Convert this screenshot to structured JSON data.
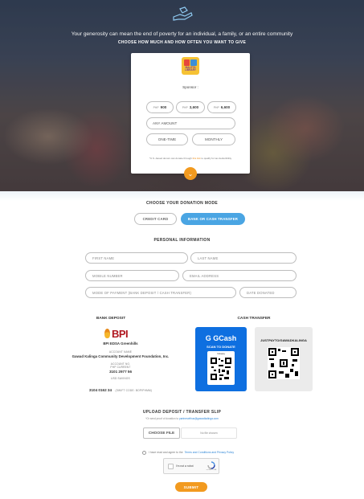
{
  "hero": {
    "tagline": "Your generosity can mean the end of poverty for an individual, a family, or an entire community",
    "subtitle": "CHOOSE HOW MUCH AND HOW OFTEN YOU WANT TO GIVE"
  },
  "card": {
    "logo_text": "MALETA LIBRARY",
    "sponsor_label": "Sponsor :",
    "amounts": [
      {
        "currency": "PHP",
        "value": "900"
      },
      {
        "currency": "PHP",
        "value": "3,600"
      },
      {
        "currency": "PHP",
        "value": "6,600"
      }
    ],
    "any_amount_placeholder": "ANY AMOUNT",
    "frequency": [
      "ONE-TIME",
      "MONTHLY"
    ],
    "tax_note_prefix": "*U.S.-based donors can donate through",
    "tax_note_link": "this link",
    "tax_note_suffix": "to qualify for tax deductibility"
  },
  "mode": {
    "title": "CHOOSE YOUR DONATION MODE",
    "credit_label": "CREDIT CARD",
    "bank_label": "BANK OR CASH TRANSFER",
    "active": "bank"
  },
  "personal": {
    "title": "PERSONAL INFORMATION",
    "first_name": "FIRST NAME",
    "last_name": "LAST NAME",
    "mobile": "MOBILE NUMBER",
    "email": "EMAIL ADDRESS",
    "payment_mode": "MODE OF PAYMENT (BANK DEPOSIT / CASH TRANSFER)",
    "date_donated": "DATE DONATED"
  },
  "bank": {
    "title": "BANK DEPOSIT",
    "logo": "BPI",
    "branch": "BPI EDSA Greenhills",
    "account_name_label": "ACCOUNT NAME",
    "account_name": "Gawad Kalinga Community Development Foundation, Inc.",
    "account_no_label": "ACCOUNT NO.",
    "account_type": "PHP CURRENT",
    "account_no": "3101 2977 56",
    "usd_label": "USD SAVINGS",
    "usd_account": "3104 0162 34",
    "swift": "(SWIFT CODE: BOPIPHMM)"
  },
  "cash": {
    "title": "CASH TRANSFER",
    "gcash_logo": "G GCash",
    "gcash_scan": "SCAN TO DONATE",
    "gcash_qr_label": "Instapay",
    "ig_handle": "JUSTPAYTO/GAWADKALINGA"
  },
  "upload": {
    "title": "UPLOAD DEPOSIT / TRANSFER SLIP",
    "sub_prefix": "*Or send proof of donation to",
    "sub_email": "partnerwithus@gawadkalinga.com",
    "choose_file": "CHOOSE FILE",
    "no_file": "No file chosen",
    "terms_prefix": "I have read and agree to the",
    "terms_link": "Terms and Conditions and Privacy Policy",
    "captcha_label": "I'm not a robot",
    "captcha_brand": "reCAPTCHA",
    "submit": "SUBMIT"
  },
  "colors": {
    "accent_orange": "#f29a1f",
    "active_blue": "#4aa5e3",
    "gcash_blue": "#0e6fe0",
    "bpi_red": "#b0171f"
  }
}
